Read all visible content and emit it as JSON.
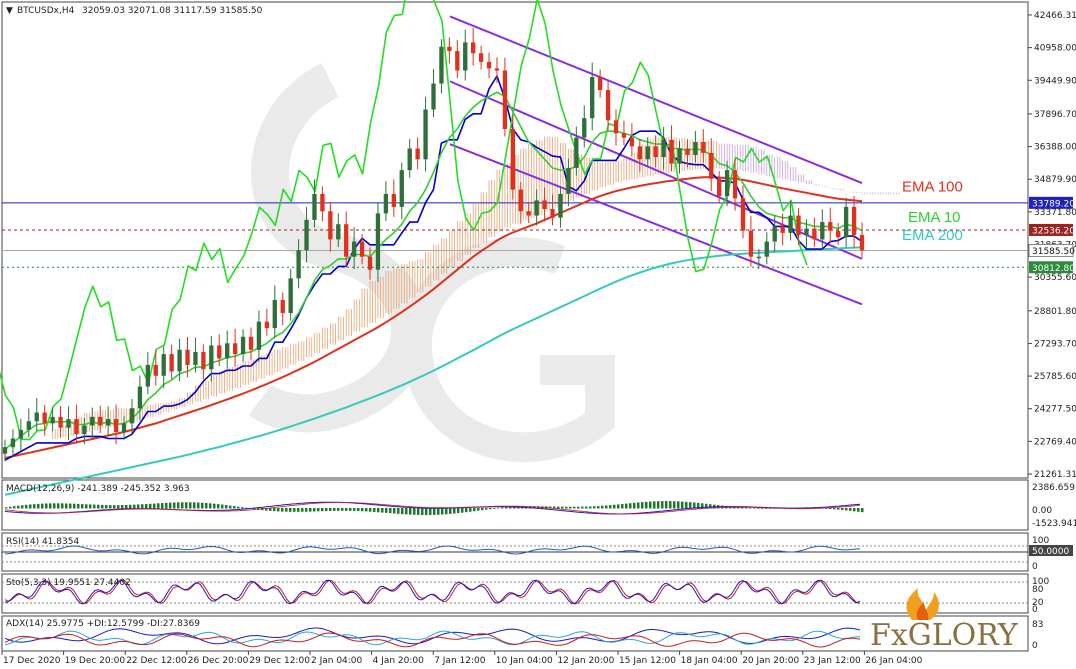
{
  "header": {
    "symbol": "BTCUSDx,H4",
    "ohlc": "32059.03 32071.08 31117.59 31585.50"
  },
  "colors": {
    "bull": "#2f6f3a",
    "bear": "#e0301e",
    "ema10": "#33cc33",
    "ema100": "#e0301e",
    "ema200": "#35c9c0",
    "channel": "#8a2be2",
    "kijun": "#0000cc",
    "chikou": "#22dd22",
    "cloud_bull": "#e8a070",
    "cloud_bear": "#c8a0d8",
    "resistance": "#2222bb",
    "current": "#992222",
    "support": "#2a8a3a"
  },
  "chart_data": {
    "type": "line",
    "price_axis": {
      "ylim": [
        21261.31,
        42466.31
      ],
      "ticks": [
        "42466.31",
        "40958.00",
        "39449.90",
        "37896.70",
        "36388.00",
        "34879.90",
        "33371.80",
        "31863.70",
        "30355.60",
        "28801.80",
        "27293.70",
        "25785.60",
        "24277.50",
        "22769.40",
        "21261.31"
      ]
    },
    "time_labels": [
      "17 Dec 2020",
      "19 Dec 20:00",
      "22 Dec 12:00",
      "26 Dec 20:00",
      "29 Dec 12:00",
      "2 Jan 04:00",
      "4 Jan 20:00",
      "7 Jan 12:00",
      "10 Jan 04:00",
      "12 Jan 20:00",
      "15 Jan 12:00",
      "18 Jan 04:00",
      "20 Jan 20:00",
      "23 Jan 12:00",
      "26 Jan 04:00"
    ],
    "levels": [
      {
        "name": "resistance",
        "value": 33789.2,
        "label": "33789.20"
      },
      {
        "name": "current",
        "value": 32536.2,
        "label": "32536.20"
      },
      {
        "name": "price",
        "value": 31585.5,
        "label": "31585.50"
      },
      {
        "name": "support",
        "value": 30812.8,
        "label": "30812.80"
      }
    ],
    "ema_labels": [
      {
        "name": "EMA 100",
        "color": "#e0301e"
      },
      {
        "name": "EMA 10",
        "color": "#33cc33"
      },
      {
        "name": "EMA 200",
        "color": "#35c9c0"
      }
    ],
    "close": [
      22500,
      22900,
      23300,
      23700,
      24100,
      23600,
      23900,
      23400,
      23800,
      23100,
      23500,
      23900,
      23500,
      23800,
      23200,
      23600,
      24300,
      25300,
      26300,
      25800,
      26800,
      26000,
      27000,
      26300,
      26900,
      26100,
      27200,
      26600,
      27300,
      26800,
      27600,
      27000,
      28300,
      28000,
      29300,
      28700,
      30300,
      31600,
      33000,
      34200,
      33400,
      32100,
      32800,
      31300,
      32000,
      31300,
      30700,
      33300,
      34200,
      33600,
      35300,
      36300,
      35800,
      38100,
      39300,
      41000,
      40800,
      39900,
      41200,
      40700,
      40300,
      40000,
      39900,
      37200,
      34400,
      33400,
      33200,
      33900,
      33500,
      33100,
      34200,
      35400,
      36800,
      37700,
      39600,
      39000,
      37600,
      37000,
      36800,
      36400,
      35800,
      36400,
      35900,
      36700,
      35600,
      36300,
      36000,
      36600,
      36100,
      34900,
      34100,
      35300,
      34000,
      32500,
      31300,
      31300,
      32000,
      32700,
      32400,
      33200,
      32300,
      32600,
      32100,
      32900,
      32500,
      32200,
      33600,
      32300,
      31600
    ],
    "ema10": [
      22400,
      22700,
      23000,
      23300,
      23550,
      23600,
      23700,
      23650,
      23700,
      23550,
      23550,
      23650,
      23600,
      23650,
      23550,
      23600,
      23800,
      24200,
      24700,
      25000,
      25400,
      25600,
      25900,
      26000,
      26200,
      26200,
      26400,
      26500,
      26650,
      26700,
      26850,
      26900,
      27100,
      27300,
      27600,
      27800,
      28200,
      28700,
      29400,
      30200,
      30700,
      30900,
      31200,
      31200,
      31400,
      31400,
      31300,
      31700,
      32100,
      32400,
      32800,
      33400,
      33800,
      34400,
      35200,
      36100,
      36800,
      37200,
      37800,
      38200,
      38500,
      38700,
      38900,
      38700,
      38000,
      37300,
      36600,
      36200,
      35800,
      35400,
      35300,
      35300,
      35500,
      35900,
      36600,
      37000,
      37100,
      37100,
      37000,
      36900,
      36700,
      36600,
      36500,
      36500,
      36300,
      36300,
      36200,
      36300,
      36200,
      36000,
      35600,
      35500,
      35200,
      34700,
      34100,
      33600,
      33300,
      33200,
      33100,
      33100,
      32900,
      32800,
      32700,
      32700,
      32700,
      32600,
      32800,
      32700,
      32500
    ],
    "ema100": [
      22000,
      22080,
      22160,
      22240,
      22320,
      22400,
      22480,
      22560,
      22640,
      22720,
      22800,
      22880,
      22960,
      23040,
      23120,
      23200,
      23300,
      23400,
      23500,
      23600,
      23720,
      23840,
      23960,
      24080,
      24200,
      24320,
      24450,
      24580,
      24710,
      24840,
      24980,
      25120,
      25270,
      25420,
      25580,
      25740,
      25910,
      26080,
      26260,
      26440,
      26640,
      26840,
      27040,
      27240,
      27440,
      27640,
      27840,
      28050,
      28270,
      28500,
      28740,
      28990,
      29250,
      29520,
      29800,
      30100,
      30400,
      30700,
      31000,
      31300,
      31560,
      31800,
      32050,
      32250,
      32420,
      32560,
      32700,
      32840,
      33000,
      33160,
      33320,
      33480,
      33640,
      33800,
      33960,
      34100,
      34220,
      34330,
      34420,
      34500,
      34570,
      34640,
      34700,
      34760,
      34810,
      34860,
      34900,
      34940,
      34970,
      34980,
      34960,
      34930,
      34900,
      34850,
      34780,
      34700,
      34620,
      34540,
      34460,
      34390,
      34320,
      34250,
      34180,
      34110,
      34040,
      33980,
      33940,
      33900,
      33860
    ],
    "ema200": [
      20300,
      20380,
      20460,
      20540,
      20620,
      20700,
      20780,
      20860,
      20940,
      21020,
      21100,
      21180,
      21260,
      21340,
      21420,
      21500,
      21580,
      21660,
      21740,
      21820,
      21900,
      21980,
      22060,
      22150,
      22240,
      22330,
      22420,
      22510,
      22610,
      22710,
      22810,
      22910,
      23010,
      23120,
      23230,
      23340,
      23460,
      23580,
      23700,
      23820,
      23950,
      24080,
      24210,
      24340,
      24480,
      24620,
      24760,
      24900,
      25050,
      25200,
      25360,
      25520,
      25690,
      25860,
      26040,
      26220,
      26410,
      26600,
      26790,
      26980,
      27180,
      27380,
      27580,
      27770,
      27950,
      28120,
      28290,
      28460,
      28630,
      28800,
      28970,
      29140,
      29310,
      29480,
      29650,
      29820,
      29990,
      30150,
      30300,
      30440,
      30570,
      30690,
      30800,
      30900,
      30990,
      31070,
      31140,
      31200,
      31250,
      31300,
      31340,
      31380,
      31410,
      31440,
      31460,
      31480,
      31500,
      31520,
      31540,
      31560,
      31580,
      31600,
      31620,
      31640,
      31660,
      31680,
      31700,
      31720,
      31740
    ]
  },
  "indicators": {
    "macd": {
      "label": "MACD(12,26,9) -241.389 -245.352 3.963",
      "ticks": [
        "2386.659",
        "0.00",
        "-1523.941"
      ]
    },
    "rsi": {
      "label": "RSI(14) 41.8354",
      "ticks": [
        "100",
        "50.0000",
        "0"
      ],
      "tag": "50.0000"
    },
    "stoch": {
      "label": "Sto(5,3,3) 19.9551 27.4402",
      "ticks": [
        "100",
        "80",
        "20",
        "0"
      ]
    },
    "adx": {
      "label": "ADX(14) 25.9775 +DI:12.5799 -DI:27.8369",
      "ticks": [
        "83",
        "0"
      ]
    }
  },
  "brand": {
    "name": "FxGLORY"
  }
}
